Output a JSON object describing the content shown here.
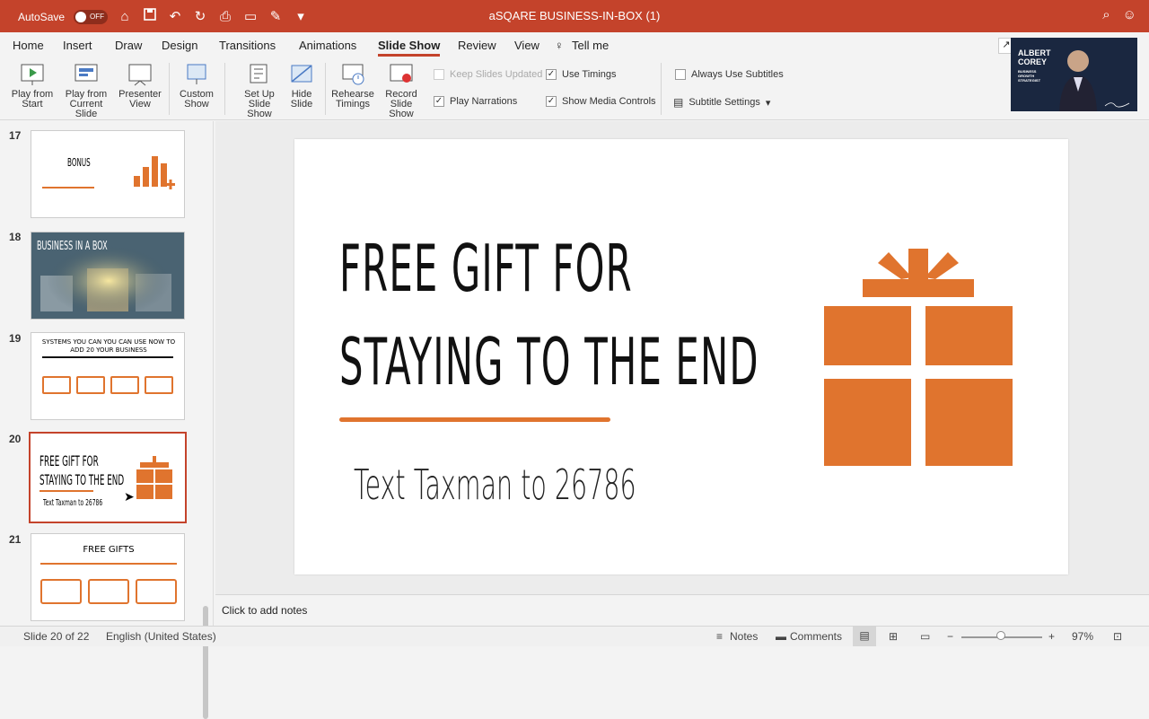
{
  "app": {
    "autosave_label": "AutoSave",
    "autosave_state": "OFF",
    "doc_title": "aSQARE BUSINESS-IN-BOX (1)",
    "accent_color": "#c4432b"
  },
  "tabs": [
    "Home",
    "Insert",
    "Draw",
    "Design",
    "Transitions",
    "Animations",
    "Slide Show",
    "Review",
    "View",
    "Tell me"
  ],
  "active_tab": "Slide Show",
  "ribbon": {
    "play_from_start": [
      "Play from",
      "Start"
    ],
    "play_from_current": [
      "Play from",
      "Current Slide"
    ],
    "presenter_view": [
      "Presenter",
      "View"
    ],
    "custom_show": [
      "Custom",
      "Show"
    ],
    "set_up": [
      "Set Up",
      "Slide Show"
    ],
    "hide_slide": [
      "Hide",
      "Slide"
    ],
    "rehearse": [
      "Rehearse",
      "Timings"
    ],
    "record": [
      "Record",
      "Slide Show"
    ],
    "keep_updated": "Keep Slides Updated",
    "use_timings": "Use Timings",
    "play_narrations": "Play Narrations",
    "show_media": "Show Media Controls",
    "always_subtitles": "Always Use Subtitles",
    "subtitle_settings": "Subtitle Settings"
  },
  "video_overlay": {
    "name_line1": "ALBERT",
    "name_line2": "COREY",
    "tagline": "BUSINESS GROWTH STRATEGIST"
  },
  "thumbnails": [
    {
      "num": "17",
      "title": "BONUS"
    },
    {
      "num": "18",
      "title": "BUSINESS IN A BOX"
    },
    {
      "num": "19",
      "title_line1": "SYSTEMS YOU CAN YOU CAN USE NOW TO",
      "title_line2": "ADD 20 YOUR BUSINESS"
    },
    {
      "num": "20",
      "title_line1": "FREE GIFT FOR",
      "title_line2": "STAYING TO THE END",
      "sub": "Text Taxman to 26786"
    },
    {
      "num": "21",
      "title": "FREE GIFTS"
    }
  ],
  "slide": {
    "title_line1": "FREE GIFT FOR",
    "title_line2": "STAYING TO THE END",
    "subtitle": "Text Taxman to 26786",
    "accent_color": "#e0742e"
  },
  "notes_placeholder": "Click to add notes",
  "status": {
    "slide_counter": "Slide 20 of 22",
    "language": "English (United States)",
    "notes_label": "Notes",
    "comments_label": "Comments",
    "zoom": "97%"
  }
}
